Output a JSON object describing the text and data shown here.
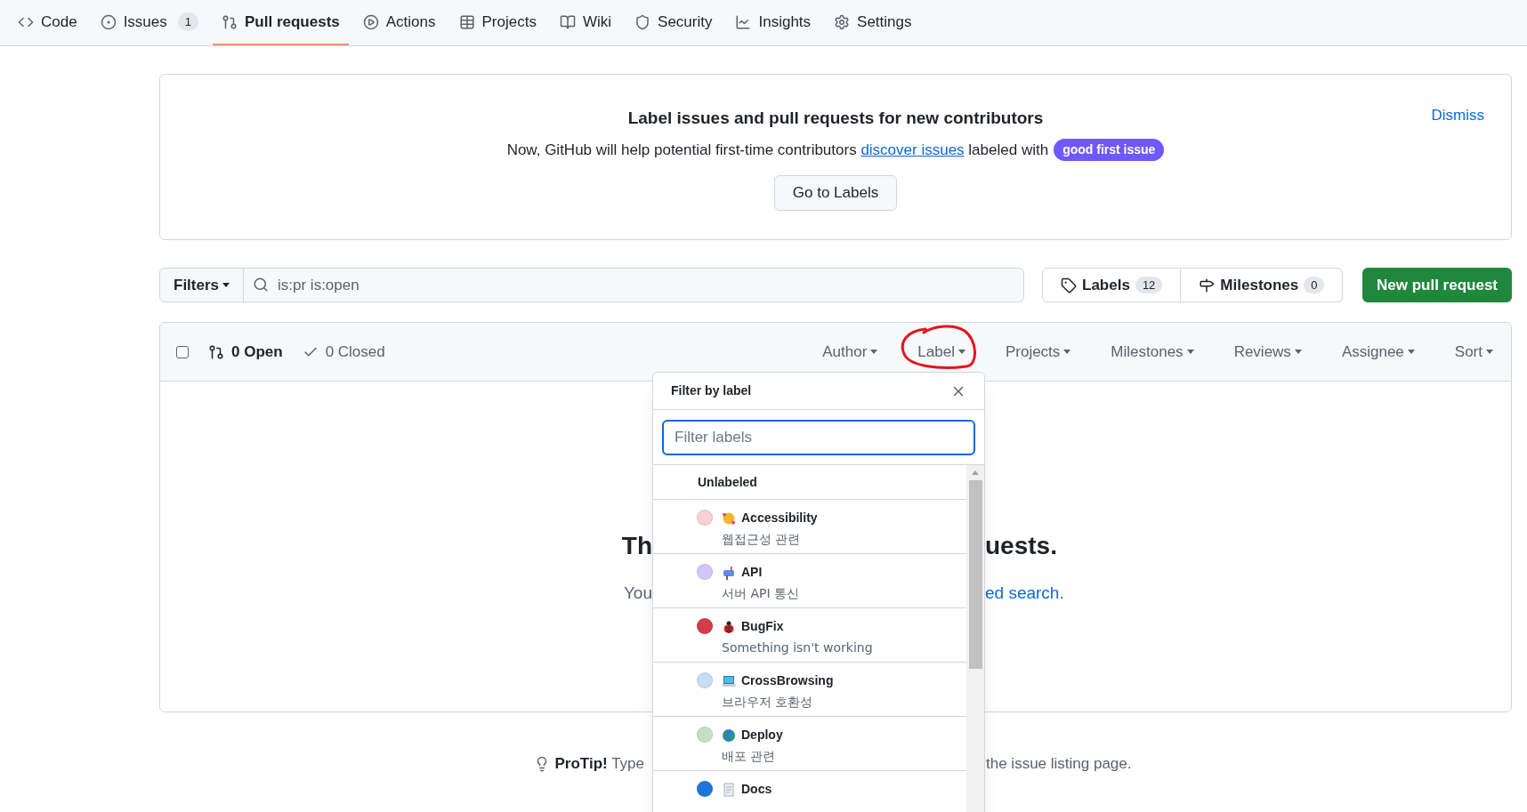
{
  "nav": {
    "tabs": [
      {
        "label": "Code",
        "selected": false
      },
      {
        "label": "Issues",
        "count": "1",
        "selected": false
      },
      {
        "label": "Pull requests",
        "selected": true
      },
      {
        "label": "Actions",
        "selected": false
      },
      {
        "label": "Projects",
        "selected": false
      },
      {
        "label": "Wiki",
        "selected": false
      },
      {
        "label": "Security",
        "selected": false
      },
      {
        "label": "Insights",
        "selected": false
      },
      {
        "label": "Settings",
        "selected": false
      }
    ]
  },
  "banner": {
    "title": "Label issues and pull requests for new contributors",
    "text_before": "Now, GitHub will help potential first-time contributors ",
    "link": "discover issues",
    "text_after": " labeled with",
    "badge": "good first issue",
    "button": "Go to Labels",
    "dismiss": "Dismiss"
  },
  "toolbar": {
    "filters": "Filters",
    "search_value": "is:pr is:open",
    "labels": {
      "label": "Labels",
      "count": "12"
    },
    "milestones": {
      "label": "Milestones",
      "count": "0"
    },
    "new_button": "New pull request"
  },
  "list_header": {
    "checked": false,
    "states": [
      {
        "label": "0 Open",
        "selected": true
      },
      {
        "label": "0 Closed",
        "selected": false
      }
    ],
    "filters": [
      "Author",
      "Label",
      "Projects",
      "Milestones",
      "Reviews",
      "Assignee",
      "Sort"
    ]
  },
  "empty": {
    "heading_left": "Th",
    "heading_right": "uests.",
    "text_left": "You",
    "text_right_link": "ed search",
    "text_right_after": "."
  },
  "protip": {
    "bold": "ProTip!",
    "left": "Type",
    "right": "the issue listing page."
  },
  "dropdown": {
    "title": "Filter by label",
    "placeholder": "Filter labels",
    "items": [
      {
        "kind": "plain",
        "name": "Unlabeled"
      },
      {
        "kind": "label",
        "color": "#f9d0d4",
        "name": "Accessibility",
        "description": "웹접근성 관련"
      },
      {
        "kind": "label",
        "color": "#d4c5f9",
        "name": "API",
        "description": "서버 API 통신"
      },
      {
        "kind": "label",
        "color": "#d73a4a",
        "name": "BugFix",
        "description": "Something isn't working"
      },
      {
        "kind": "label",
        "color": "#c5def5",
        "name": "CrossBrowsing",
        "description": "브라우저 호환성"
      },
      {
        "kind": "label",
        "color": "#c2e0c6",
        "name": "Deploy",
        "description": "배포 관련"
      },
      {
        "kind": "label",
        "color": "#1d76db",
        "name": "Docs"
      }
    ]
  }
}
